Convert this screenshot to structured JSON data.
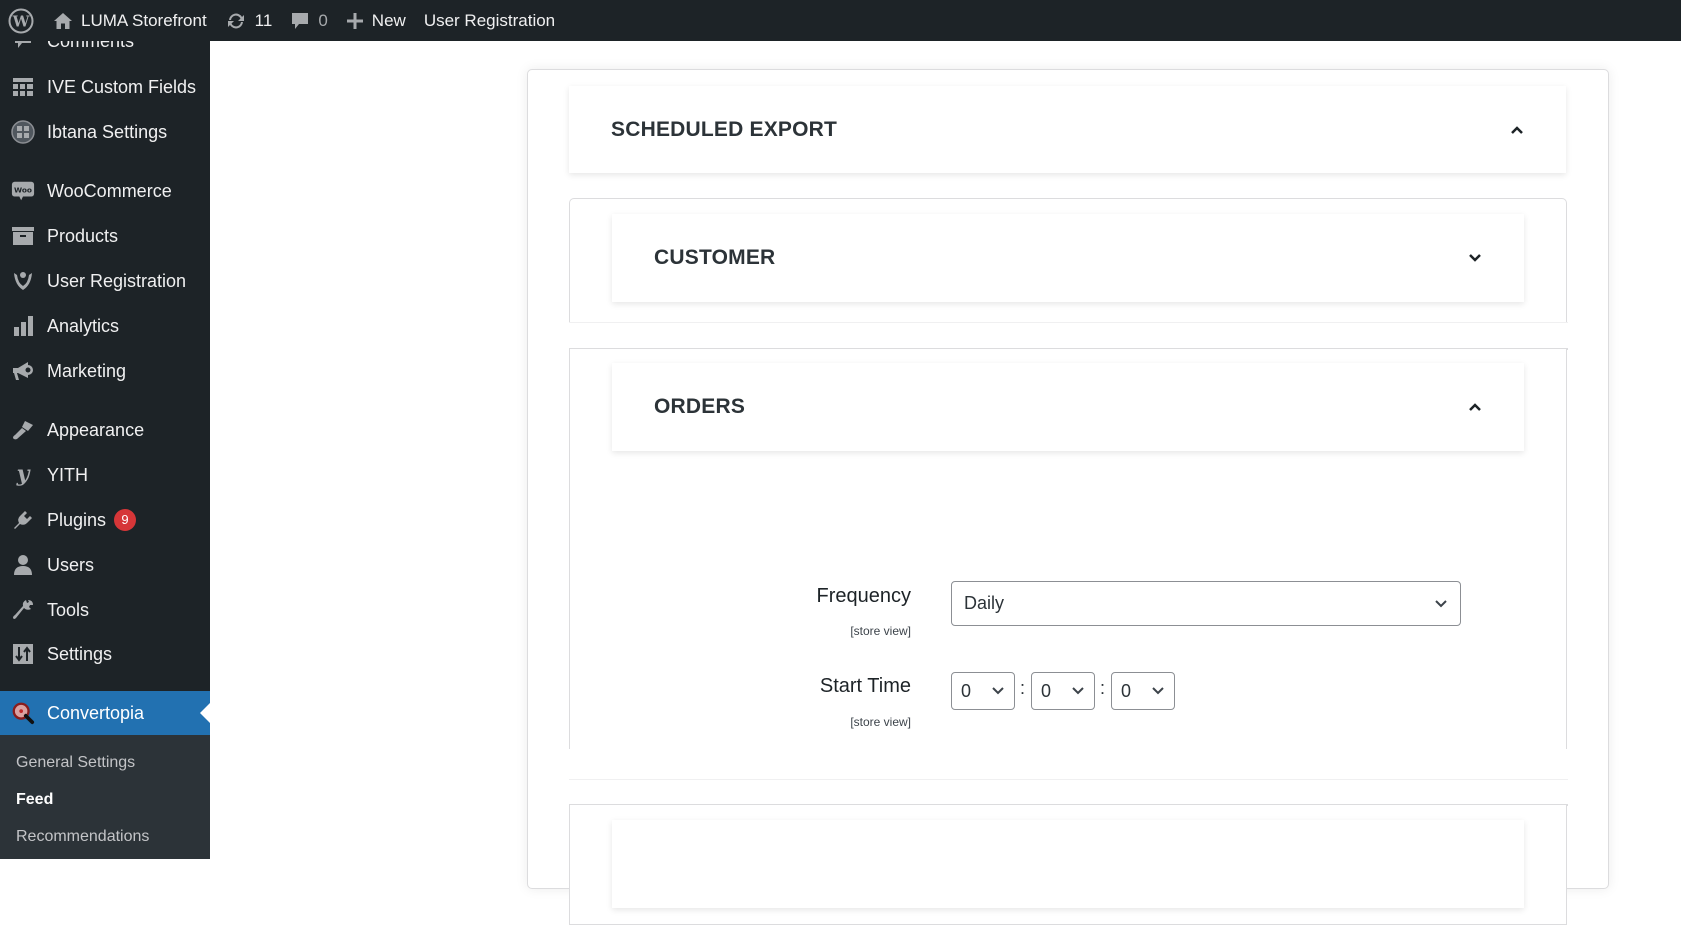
{
  "adminbar": {
    "site_name": "LUMA Storefront",
    "updates_count": "11",
    "comments_count": "0",
    "new_label": "New",
    "plugin_link": "User Registration"
  },
  "sidebar": {
    "items": [
      {
        "label": "Comments",
        "icon": "comment-icon"
      },
      {
        "label": "IVE Custom Fields",
        "icon": "grid-fields-icon"
      },
      {
        "label": "Ibtana Settings",
        "icon": "ibtana-icon"
      },
      {
        "label": "WooCommerce",
        "icon": "woo-icon"
      },
      {
        "label": "Products",
        "icon": "archive-box-icon"
      },
      {
        "label": "User Registration",
        "icon": "user-registration-icon"
      },
      {
        "label": "Analytics",
        "icon": "bar-chart-icon"
      },
      {
        "label": "Marketing",
        "icon": "megaphone-icon"
      },
      {
        "label": "Appearance",
        "icon": "paintbrush-icon"
      },
      {
        "label": "YITH",
        "icon": "yith-icon"
      },
      {
        "label": "Plugins",
        "icon": "plug-icon",
        "badge": "9"
      },
      {
        "label": "Users",
        "icon": "user-icon"
      },
      {
        "label": "Tools",
        "icon": "wrench-icon"
      },
      {
        "label": "Settings",
        "icon": "sliders-icon"
      },
      {
        "label": "Convertopia",
        "icon": "convertopia-icon",
        "active": true
      }
    ],
    "submenu": [
      {
        "label": "General Settings"
      },
      {
        "label": "Feed",
        "current": true
      },
      {
        "label": "Recommendations"
      }
    ]
  },
  "main": {
    "scheduled_export": {
      "title": "SCHEDULED EXPORT",
      "expanded": true
    },
    "customer": {
      "title": "CUSTOMER",
      "expanded": false
    },
    "orders": {
      "title": "ORDERS",
      "expanded": true,
      "fields": {
        "frequency": {
          "label": "Frequency",
          "scope": "[store view]",
          "value": "Daily"
        },
        "start_time": {
          "label": "Start Time",
          "scope": "[store view]",
          "hour": "0",
          "minute": "0",
          "second": "0",
          "separator": ":"
        }
      }
    }
  },
  "colors": {
    "adminbar_bg": "#1d2327",
    "sidebar_active": "#2271b1",
    "badge": "#d63638"
  }
}
